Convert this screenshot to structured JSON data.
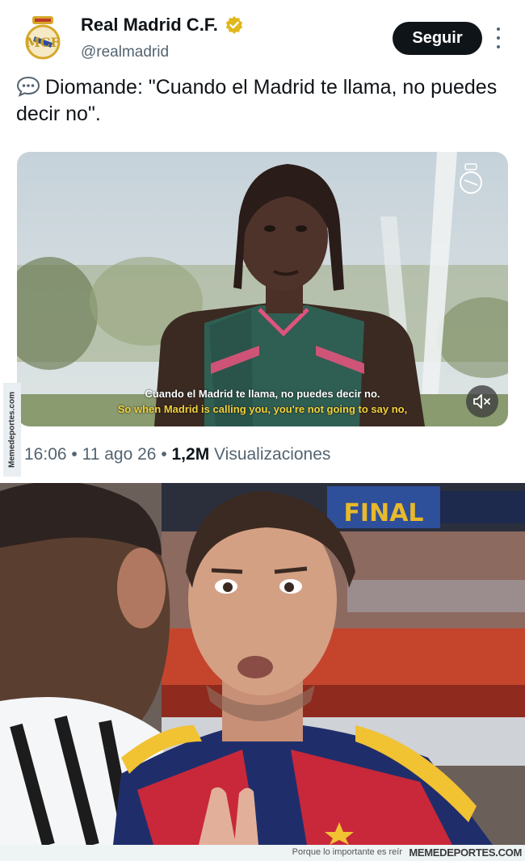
{
  "tweet": {
    "account_name": "Real Madrid C.F.",
    "handle": "@realmadrid",
    "follow_label": "Seguir",
    "text": "Diomande: \"Cuando el Madrid te llama, no puedes decir no\".",
    "time": "16:06",
    "date": "11 ago 26",
    "views_count": "1,2M",
    "views_label": "Visualizaciones"
  },
  "video": {
    "subtitle_es": "Cuando el Madrid te llama, no puedes decir no.",
    "subtitle_en": "So when Madrid is calling you, you're not going to say no,"
  },
  "icons": [
    "real-madrid-crest-icon",
    "verified-badge-icon",
    "more-options-icon",
    "speech-bubble-icon",
    "volume-muted-icon"
  ],
  "colors": {
    "follow_button_bg": "#0f1419",
    "verified_gold": "#e2b719",
    "subtitle_yellow": "#f5d33a"
  },
  "watermark": {
    "side_text": "Memedeportes.com",
    "tagline": "Porque lo importante es reír",
    "brand": "MEMEDEPORTES.COM"
  },
  "photo": {
    "banner_text": "FINAL"
  }
}
